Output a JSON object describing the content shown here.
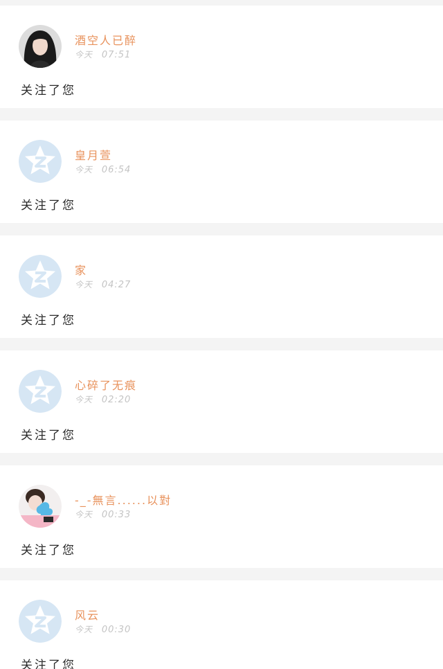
{
  "theme": {
    "name_color": "#e8925c",
    "time_color": "#c4c4c4",
    "text_color": "#2a2a2a",
    "default_avatar_bg": "#d6e6f4",
    "separator_color": "#f4f4f4"
  },
  "notifications": [
    {
      "name": "酒空人已醉",
      "day": "今天",
      "time": "07:51",
      "action": "关注了您",
      "avatar": "photo-girl"
    },
    {
      "name": "皇月萱",
      "day": "今天",
      "time": "06:54",
      "action": "关注了您",
      "avatar": "default-qq-star"
    },
    {
      "name": "家",
      "day": "今天",
      "time": "04:27",
      "action": "关注了您",
      "avatar": "default-qq-star"
    },
    {
      "name": "心碎了无痕",
      "day": "今天",
      "time": "02:20",
      "action": "关注了您",
      "avatar": "default-qq-star"
    },
    {
      "name": "-_-無言......以對",
      "day": "今天",
      "time": "00:33",
      "action": "关注了您",
      "avatar": "photo-blue-flower"
    },
    {
      "name": "风云",
      "day": "今天",
      "time": "00:30",
      "action": "关注了您",
      "avatar": "default-qq-star"
    }
  ]
}
